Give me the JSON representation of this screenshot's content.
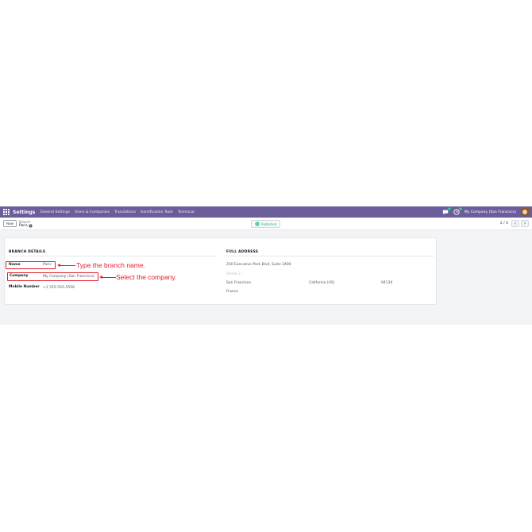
{
  "navbar": {
    "app_name": "Settings",
    "menu": [
      "General Settings",
      "Users & Companies",
      "Translations",
      "Gamification Tools",
      "Technical"
    ],
    "chat_badge": "7",
    "activity_badge": "4",
    "company": "My Company (San Francisco)",
    "accent_color": "#6b5d9a"
  },
  "control": {
    "new_label": "New",
    "breadcrumb_parent": "Branch",
    "breadcrumb_current": "Paris",
    "status": "Published",
    "pager": "2 / 4"
  },
  "form": {
    "branch_section": "BRANCH DETAILS",
    "address_section": "FULL ADDRESS",
    "fields": {
      "name_label": "Name",
      "name_value": "Paris",
      "company_label": "Company",
      "company_value": "My Company (San Francisco)",
      "mobile_label": "Mobile Number",
      "mobile_value": "+1 555-555-5556"
    },
    "address": {
      "street": "250 Executive Park Blvd, Suite 3400",
      "street2_placeholder": "Street 2...",
      "city": "San Francisco",
      "state": "California (US)",
      "zip": "94134",
      "country": "France"
    }
  },
  "annotations": {
    "name_hint": "Type the branch name.",
    "company_hint": "Select the company.",
    "color": "#e11d2a"
  }
}
